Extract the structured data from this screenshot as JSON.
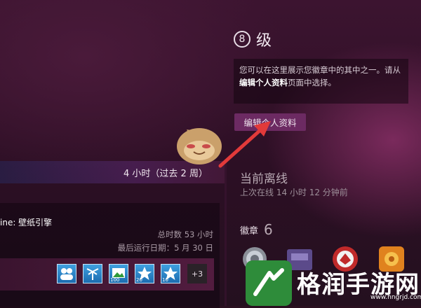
{
  "profile": {
    "level_number": "8",
    "level_label": "级",
    "showcase_note_part1": "您可以在这里展示您徽章中的其中之一。请从",
    "showcase_note_bold": "编辑个人资料",
    "showcase_note_part2": "页面中选择。",
    "edit_profile_label": "编辑个人资料",
    "status_title": "当前离线",
    "last_online": "上次在线 14 小时 12 分钟前",
    "badges_heading": "徽章",
    "badges_count": "6"
  },
  "activity": {
    "hours_summary": "4 小时（过去 2 周）",
    "game_name": "ine: 壁纸引擎",
    "total_hours": "总时数 53 小时",
    "last_played": "最后运行日期：5 月 30 日",
    "achievement_icons": [
      {
        "name": "group-icon",
        "num": ""
      },
      {
        "name": "palm-tree-icon",
        "num": ""
      },
      {
        "name": "image-icon",
        "num": "100"
      },
      {
        "name": "star-icon",
        "num": "20"
      },
      {
        "name": "star-icon",
        "num": "10"
      }
    ],
    "more_label": "+3"
  },
  "watermark": {
    "brand": "格润手游网",
    "url": "www.hngrjd.com"
  }
}
